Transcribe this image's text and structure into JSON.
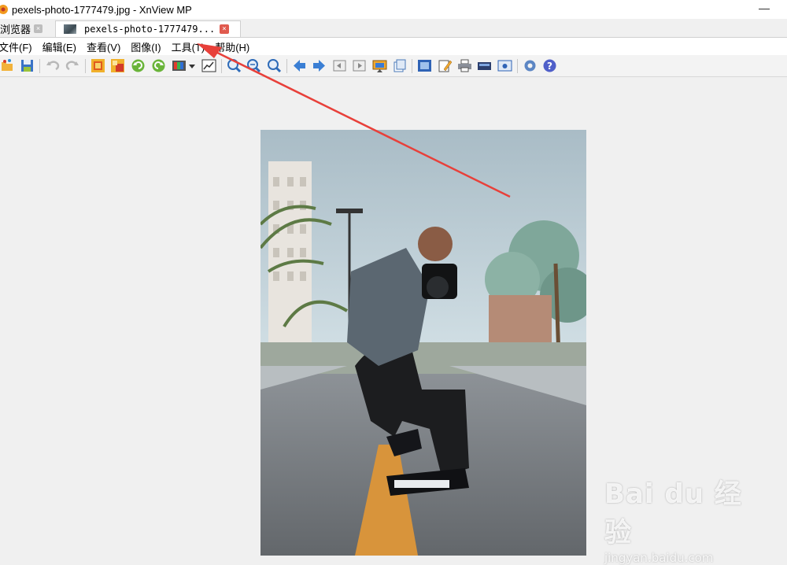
{
  "window": {
    "title": "pexels-photo-1777479.jpg - XnView MP",
    "minimize_glyph": "—"
  },
  "tabs": [
    {
      "label": "浏览器",
      "close": "×"
    },
    {
      "label": "pexels-photo-1777479...",
      "close": "×"
    }
  ],
  "menu": [
    {
      "label": "文件(F)"
    },
    {
      "label": "编辑(E)"
    },
    {
      "label": "查看(V)"
    },
    {
      "label": "图像(I)"
    },
    {
      "label": "工具(T)"
    },
    {
      "label": "帮助(H)"
    }
  ],
  "toolbar": {
    "icons": [
      "browse-icon",
      "save-icon",
      "undo-icon",
      "redo-icon",
      "crop-icon",
      "resize-icon",
      "rotate-left-icon",
      "rotate-right-icon",
      "adjust-colors-icon",
      "dropdown-arrow-icon",
      "histogram-icon",
      "zoom-in-icon",
      "zoom-out-icon",
      "zoom-fit-icon",
      "previous-icon",
      "next-icon",
      "first-icon",
      "last-icon",
      "slideshow-icon",
      "copy-icon",
      "fullscreen-icon",
      "edit-icon",
      "print-icon",
      "scan-icon",
      "capture-icon",
      "settings-icon",
      "help-icon"
    ]
  },
  "watermark": {
    "main": "Bai du 经验",
    "sub": "jingyan.baidu.com"
  },
  "colors": {
    "annotation_arrow": "#e8403a",
    "menu_bg": "#ffffff",
    "toolbar_bg": "#f3f3f3"
  }
}
